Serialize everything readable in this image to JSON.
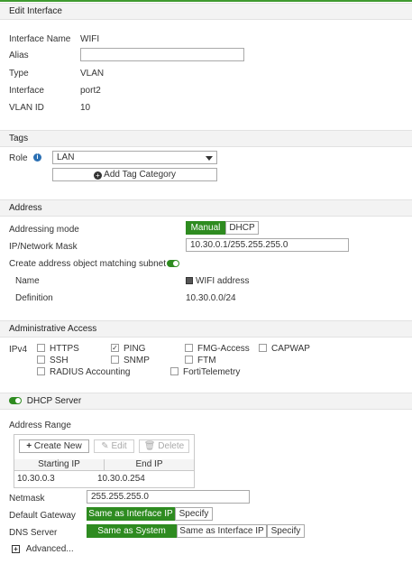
{
  "colors": {
    "accent": "#2e8b20",
    "section_bg": "#f3f3f3",
    "info_icon": "#2a6fb3"
  },
  "header": {
    "title": "Edit Interface"
  },
  "general": {
    "interface_name_label": "Interface Name",
    "interface_name": "WIFI",
    "alias_label": "Alias",
    "alias_value": "",
    "type_label": "Type",
    "type_value": "VLAN",
    "interface_label": "Interface",
    "interface_value": "port2",
    "vlan_id_label": "VLAN ID",
    "vlan_id_value": "10"
  },
  "tags": {
    "title": "Tags",
    "role_label": "Role",
    "role_value": "LAN",
    "add_tag_label": "Add Tag Category"
  },
  "address": {
    "title": "Address",
    "mode_label": "Addressing mode",
    "mode_manual": "Manual",
    "mode_dhcp": "DHCP",
    "mask_label": "IP/Network Mask",
    "mask_value": "10.30.0.1/255.255.255.0",
    "create_obj_label": "Create address object matching subnet",
    "name_label": "Name",
    "name_value": "WIFI address",
    "definition_label": "Definition",
    "definition_value": "10.30.0.0/24"
  },
  "admin": {
    "title": "Administrative Access",
    "ipv4_label": "IPv4",
    "items": [
      {
        "label": "HTTPS",
        "checked": false
      },
      {
        "label": "PING",
        "checked": true
      },
      {
        "label": "FMG-Access",
        "checked": false
      },
      {
        "label": "CAPWAP",
        "checked": false
      },
      {
        "label": "SSH",
        "checked": false
      },
      {
        "label": "SNMP",
        "checked": false
      },
      {
        "label": "FTM",
        "checked": false
      },
      {
        "label": "RADIUS Accounting",
        "checked": false
      },
      {
        "label": "FortiTelemetry",
        "checked": false
      }
    ]
  },
  "dhcp": {
    "server_label": "DHCP Server",
    "range_label": "Address Range",
    "create_new": "Create New",
    "edit": "Edit",
    "delete": "Delete",
    "col_start": "Starting IP",
    "col_end": "End IP",
    "rows": [
      {
        "start": "10.30.0.3",
        "end": "10.30.0.254"
      }
    ],
    "netmask_label": "Netmask",
    "netmask_value": "255.255.255.0",
    "gateway_label": "Default Gateway",
    "gateway_same": "Same as Interface IP",
    "gateway_specify": "Specify",
    "dns_label": "DNS Server",
    "dns_same_system": "Same as System DNS",
    "dns_same_iface": "Same as Interface IP",
    "dns_specify": "Specify",
    "advanced_label": "Advanced..."
  }
}
